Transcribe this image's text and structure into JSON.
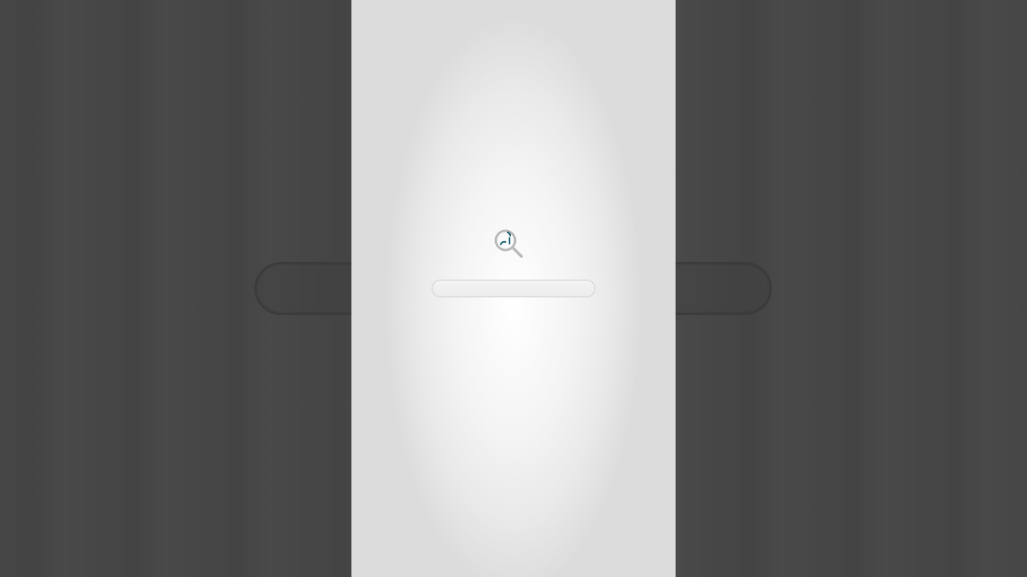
{
  "loading": {
    "progress": 0,
    "icon": "search-icon",
    "accent_color": "#1a5f73",
    "ring_color": "#b9b9b9"
  },
  "background": {
    "color": "#464646",
    "panel_color": "#f2f2f2"
  }
}
